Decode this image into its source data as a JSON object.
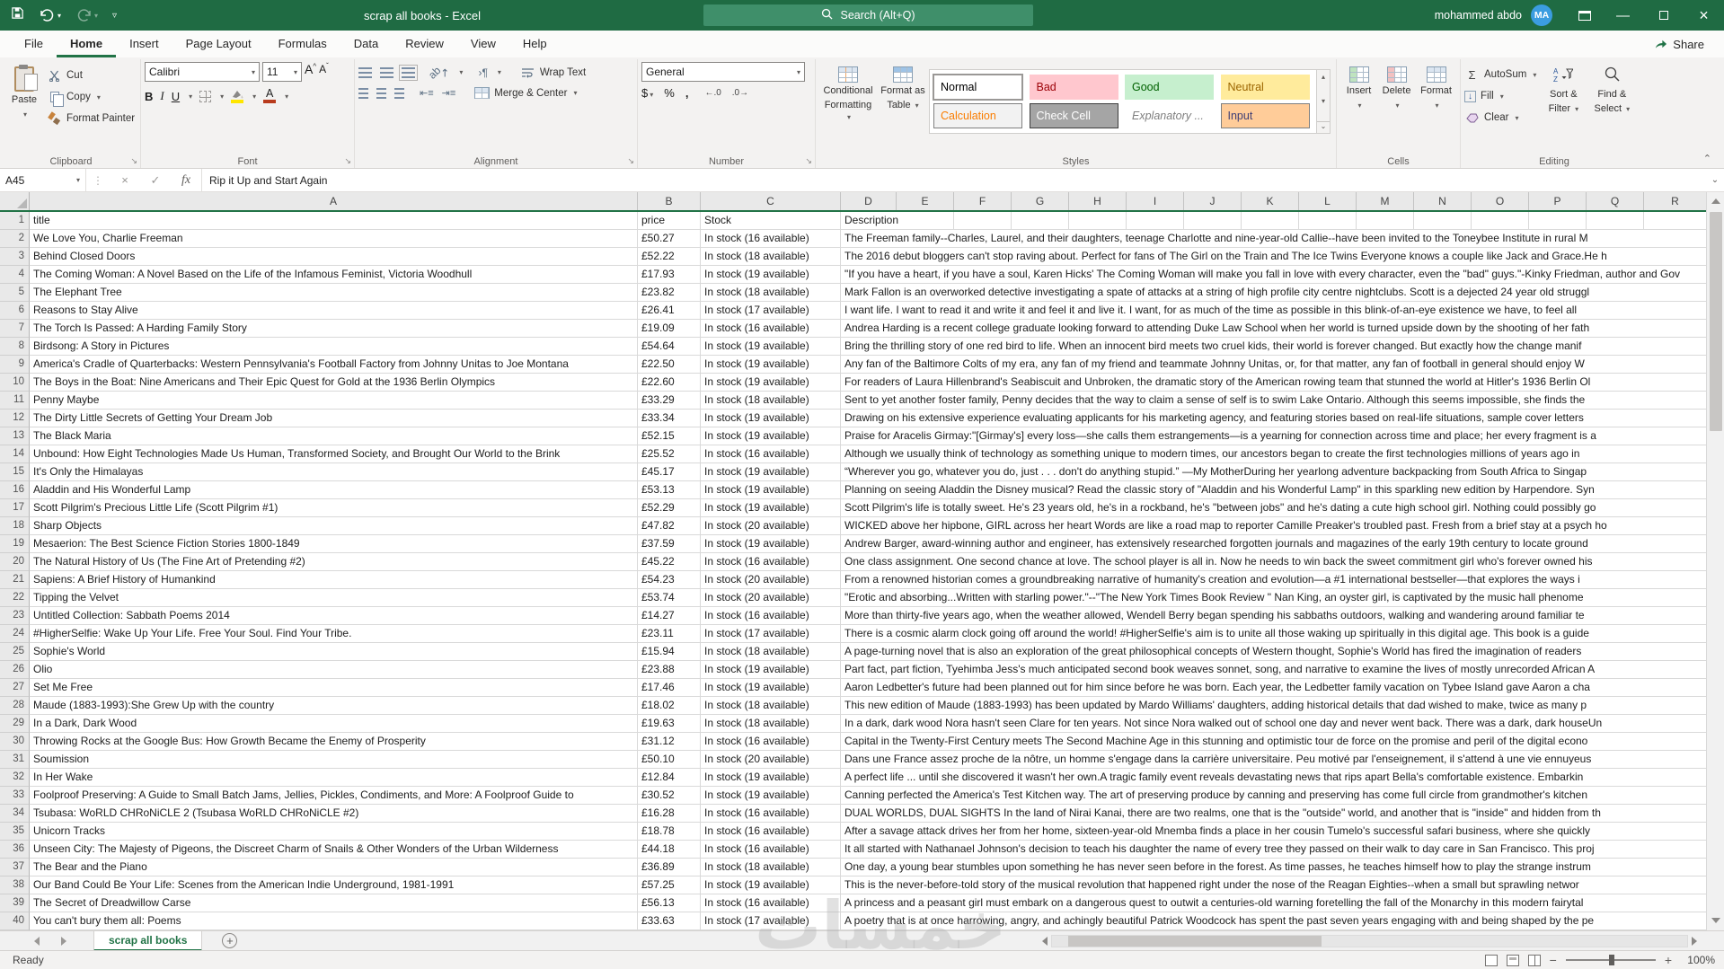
{
  "colors": {
    "accent": "#217346",
    "titlebar_green": "#1f6b43",
    "search_green": "#3f8f6a",
    "avatar_blue": "#3b9de0",
    "fill_bar_yellow": "#ffe600",
    "font_color_bar": "#b83b1d",
    "gridline": "#d9d9d9"
  },
  "icons": {
    "caret": "▾",
    "launcher": "↘",
    "check": "✓",
    "close": "×",
    "minimize": "—",
    "dots": "⋮",
    "up": "▴",
    "down": "▾",
    "more": "⌄",
    "plus": "+",
    "paragraph": "¶",
    "sigma": "Σ",
    "expand": "⌄",
    "fill_arrow": "↓",
    "az_a": "A",
    "az_z": "Z"
  },
  "titlebar": {
    "title": "scrap all books - Excel",
    "search_placeholder": "Search (Alt+Q)",
    "user": "mohammed abdo",
    "avatar_initials": "MA"
  },
  "menu": {
    "tabs": [
      "File",
      "Home",
      "Insert",
      "Page Layout",
      "Formulas",
      "Data",
      "Review",
      "View",
      "Help"
    ],
    "active": "Home",
    "share": "Share"
  },
  "ribbon": {
    "clipboard": {
      "label": "Clipboard",
      "paste": "Paste",
      "cut": "Cut",
      "copy": "Copy",
      "format_painter": "Format Painter"
    },
    "font": {
      "label": "Font",
      "family": "Calibri",
      "size": "11",
      "bold": "B",
      "italic": "I",
      "underline": "U",
      "grow": "A",
      "shrink": "A",
      "color_a": "A",
      "ab": "ab"
    },
    "alignment": {
      "label": "Alignment",
      "wrap": "Wrap Text",
      "merge": "Merge & Center"
    },
    "number": {
      "label": "Number",
      "format": "General",
      "currency": "$",
      "percent": "%",
      "comma": ",",
      "inc": "←.0",
      "dec": ".0→"
    },
    "styles": {
      "label": "Styles",
      "conditional_1": "Conditional",
      "conditional_2": "Formatting",
      "format_table_1": "Format as",
      "format_table_2": "Table",
      "chips": [
        {
          "label": "Normal",
          "bg": "#ffffff",
          "color": "#000000",
          "border": "#ababab",
          "selected": true
        },
        {
          "label": "Calculation",
          "bg": "#f2f2f2",
          "color": "#fa7d00",
          "border": "#7f7f7f"
        },
        {
          "label": "Bad",
          "bg": "#ffc7ce",
          "color": "#9c0006"
        },
        {
          "label": "Check Cell",
          "bg": "#a5a5a5",
          "color": "#ffffff",
          "border": "#3f3f3f"
        },
        {
          "label": "Good",
          "bg": "#c6efce",
          "color": "#006100"
        },
        {
          "label": "Explanatory ...",
          "bg": "#ffffff",
          "color": "#7f7f7f",
          "italic": true
        },
        {
          "label": "Neutral",
          "bg": "#ffeb9c",
          "color": "#9c6500"
        },
        {
          "label": "Input",
          "bg": "#ffcc99",
          "color": "#3f3f76",
          "border": "#7f7f7f"
        }
      ]
    },
    "cells": {
      "label": "Cells",
      "insert": "Insert",
      "delete": "Delete",
      "format": "Format"
    },
    "editing": {
      "label": "Editing",
      "autosum": "AutoSum",
      "fill": "Fill",
      "clear": "Clear",
      "sort_1": "Sort &",
      "sort_2": "Filter",
      "find_1": "Find &",
      "find_2": "Select"
    }
  },
  "formula_bar": {
    "name_box": "A45",
    "fx": "fx",
    "value": "Rip it Up and Start Again"
  },
  "grid": {
    "col_letters": [
      "A",
      "B",
      "C",
      "D",
      "E",
      "F",
      "G",
      "H",
      "I",
      "J",
      "K",
      "L",
      "M",
      "N",
      "O",
      "P",
      "Q",
      "R"
    ],
    "header_row": {
      "n": 1,
      "title": "title",
      "price": "price",
      "stock": "Stock",
      "desc": "Description"
    },
    "rows": [
      {
        "n": 2,
        "title": "We Love You, Charlie Freeman",
        "price": "£50.27",
        "stock": "In stock (16 available)",
        "desc": "The Freeman family--Charles, Laurel, and their daughters, teenage Charlotte and nine-year-old Callie--have been invited to the Toneybee Institute in rural M"
      },
      {
        "n": 3,
        "title": "Behind Closed Doors",
        "price": "£52.22",
        "stock": "In stock (18 available)",
        "desc": "The 2016 debut bloggers can't stop raving about. Perfect for fans of The Girl on the Train and The Ice Twins Everyone knows a couple like Jack and Grace.He h"
      },
      {
        "n": 4,
        "title": "The Coming Woman: A Novel Based on the Life of the Infamous Feminist, Victoria Woodhull",
        "price": "£17.93",
        "stock": "In stock (19 available)",
        "desc": "\"If you have a heart, if you have a soul, Karen Hicks' The Coming Woman will make you fall in love with every character, even the \"bad\" guys.\"-Kinky Friedman, author and Gov"
      },
      {
        "n": 5,
        "title": "The Elephant Tree",
        "price": "£23.82",
        "stock": "In stock (18 available)",
        "desc": "Mark Fallon is an overworked detective investigating a spate of attacks at a string of high profile city centre nightclubs. Scott is a dejected 24 year old struggl"
      },
      {
        "n": 6,
        "title": "Reasons to Stay Alive",
        "price": "£26.41",
        "stock": "In stock (17 available)",
        "desc": "I want life. I want to read it and write it and feel it and live it. I want, for as much of the time as possible in this blink-of-an-eye existence we have, to feel all"
      },
      {
        "n": 7,
        "title": "The Torch Is Passed: A Harding Family Story",
        "price": "£19.09",
        "stock": "In stock (16 available)",
        "desc": "Andrea Harding is a recent college graduate looking forward to attending Duke Law School when her world is turned upside down by the shooting of her fath"
      },
      {
        "n": 8,
        "title": "Birdsong: A Story in Pictures",
        "price": "£54.64",
        "stock": "In stock (19 available)",
        "desc": "Bring the thrilling story of one red bird to life. When an innocent bird meets two cruel kids, their world is forever changed. But exactly how the change manif"
      },
      {
        "n": 9,
        "title": "America's Cradle of Quarterbacks: Western Pennsylvania's Football Factory from Johnny Unitas to Joe Montana",
        "price": "£22.50",
        "stock": "In stock (19 available)",
        "desc": "Any fan of the Baltimore Colts of my era, any fan of my friend and teammate Johnny Unitas, or, for that matter, any fan of football in general should enjoy W"
      },
      {
        "n": 10,
        "title": "The Boys in the Boat: Nine Americans and Their Epic Quest for Gold at the 1936 Berlin Olympics",
        "price": "£22.60",
        "stock": "In stock (19 available)",
        "desc": "For readers of Laura Hillenbrand's Seabiscuit and Unbroken, the dramatic story of the American rowing team that stunned the world at Hitler's 1936 Berlin Ol"
      },
      {
        "n": 11,
        "title": "Penny Maybe",
        "price": "£33.29",
        "stock": "In stock (18 available)",
        "desc": "Sent to yet another foster family, Penny decides that the way to claim a sense of self is to swim Lake Ontario. Although this seems impossible, she finds the"
      },
      {
        "n": 12,
        "title": "The Dirty Little Secrets of Getting Your Dream Job",
        "price": "£33.34",
        "stock": "In stock (19 available)",
        "desc": "Drawing on his extensive experience evaluating applicants for his marketing agency, and featuring stories based on real-life situations, sample cover letters"
      },
      {
        "n": 13,
        "title": "The Black Maria",
        "price": "£52.15",
        "stock": "In stock (19 available)",
        "desc": "Praise for Aracelis Girmay:\"[Girmay's] every loss—she calls them estrangements—is a yearning for connection across time and place; her every fragment is a"
      },
      {
        "n": 14,
        "title": "Unbound: How Eight Technologies Made Us Human, Transformed Society, and Brought Our World to the Brink",
        "price": "£25.52",
        "stock": "In stock (16 available)",
        "desc": "Although we usually think of technology as something unique to modern times, our ancestors began to create the first technologies millions of years ago in"
      },
      {
        "n": 15,
        "title": "It's Only the Himalayas",
        "price": "£45.17",
        "stock": "In stock (19 available)",
        "desc": "“Wherever you go, whatever you do, just . . . don't do anything stupid.” —My MotherDuring her yearlong adventure backpacking from South Africa to Singap"
      },
      {
        "n": 16,
        "title": "Aladdin and His Wonderful Lamp",
        "price": "£53.13",
        "stock": "In stock (19 available)",
        "desc": "Planning on seeing Aladdin the Disney musical? Read the classic story of \"Aladdin and his Wonderful Lamp\" in this sparkling new edition by Harpendore. Syn"
      },
      {
        "n": 17,
        "title": "Scott Pilgrim's Precious Little Life (Scott Pilgrim #1)",
        "price": "£52.29",
        "stock": "In stock (19 available)",
        "desc": "Scott Pilgrim's life is totally sweet. He's 23 years old, he's in a rockband, he's \"between jobs\" and he's dating a cute high school girl. Nothing could possibly go"
      },
      {
        "n": 18,
        "title": "Sharp Objects",
        "price": "£47.82",
        "stock": "In stock (20 available)",
        "desc": "WICKED above her hipbone, GIRL across her heart Words are like a road map to reporter Camille Preaker's troubled past. Fresh from a brief stay at a psych ho"
      },
      {
        "n": 19,
        "title": "Mesaerion: The Best Science Fiction Stories 1800-1849",
        "price": "£37.59",
        "stock": "In stock (19 available)",
        "desc": "Andrew Barger, award-winning author and engineer, has extensively researched forgotten journals and magazines of the early 19th century to locate ground"
      },
      {
        "n": 20,
        "title": "The Natural History of Us (The Fine Art of Pretending #2)",
        "price": "£45.22",
        "stock": "In stock (16 available)",
        "desc": "One class assignment. One second chance at love. The school player is all in. Now he needs to win back the sweet commitment girl who's forever owned his"
      },
      {
        "n": 21,
        "title": "Sapiens: A Brief History of Humankind",
        "price": "£54.23",
        "stock": "In stock (20 available)",
        "desc": "From a renowned historian comes a groundbreaking narrative of humanity's creation and evolution—a #1 international bestseller—that explores the ways i"
      },
      {
        "n": 22,
        "title": "Tipping the Velvet",
        "price": "£53.74",
        "stock": "In stock (20 available)",
        "desc": "\"Erotic and absorbing...Written with starling power.\"--\"The New York Times Book Review \" Nan King, an oyster girl, is captivated by the music hall phenome"
      },
      {
        "n": 23,
        "title": "Untitled Collection: Sabbath Poems 2014",
        "price": "£14.27",
        "stock": "In stock (16 available)",
        "desc": "More than thirty-five years ago, when the weather allowed, Wendell Berry began spending his sabbaths outdoors, walking and wandering around familiar te"
      },
      {
        "n": 24,
        "title": "#HigherSelfie: Wake Up Your Life. Free Your Soul. Find Your Tribe.",
        "price": "£23.11",
        "stock": "In stock (17 available)",
        "desc": "There is a cosmic alarm clock going off around the world! #HigherSelfie's aim is to unite all those waking up spiritually in this digital age. This book is a guide"
      },
      {
        "n": 25,
        "title": "Sophie's World",
        "price": "£15.94",
        "stock": "In stock (18 available)",
        "desc": "A page-turning novel that is also an exploration of the great philosophical concepts of Western thought, Sophie's World has fired the imagination of readers"
      },
      {
        "n": 26,
        "title": "Olio",
        "price": "£23.88",
        "stock": "In stock (19 available)",
        "desc": "Part fact, part fiction, Tyehimba Jess's much anticipated second book weaves sonnet, song, and narrative to examine the lives of mostly unrecorded African A"
      },
      {
        "n": 27,
        "title": "Set Me Free",
        "price": "£17.46",
        "stock": "In stock (19 available)",
        "desc": "Aaron Ledbetter's future had been planned out for him since before he was born. Each year, the Ledbetter family vacation on Tybee Island gave Aaron a cha"
      },
      {
        "n": 28,
        "title": "Maude (1883-1993):She Grew Up with the country",
        "price": "£18.02",
        "stock": "In stock (18 available)",
        "desc": "This new edition of Maude (1883-1993) has been updated by Mardo Williams' daughters, adding historical details that dad wished to make, twice as many p"
      },
      {
        "n": 29,
        "title": "In a Dark, Dark Wood",
        "price": "£19.63",
        "stock": "In stock (18 available)",
        "desc": "In a dark, dark wood Nora hasn't seen Clare for ten years. Not since Nora walked out of school one day and never went back. There was a dark, dark houseUn"
      },
      {
        "n": 30,
        "title": "Throwing Rocks at the Google Bus: How Growth Became the Enemy of Prosperity",
        "price": "£31.12",
        "stock": "In stock (16 available)",
        "desc": "Capital in the Twenty-First Century meets The Second Machine Age in this stunning and optimistic tour de force on the promise and peril of the digital econo"
      },
      {
        "n": 31,
        "title": "Soumission",
        "price": "£50.10",
        "stock": "In stock (20 available)",
        "desc": "Dans une France assez proche de la nôtre, un homme s'engage dans la carrière universitaire. Peu motivé par l'enseignement, il s'attend à une vie ennuyeus"
      },
      {
        "n": 32,
        "title": "In Her Wake",
        "price": "£12.84",
        "stock": "In stock (19 available)",
        "desc": "A perfect life ... until she discovered it wasn't her own.A tragic family event reveals devastating news that rips apart Bella's comfortable existence. Embarkin"
      },
      {
        "n": 33,
        "title": "Foolproof Preserving: A Guide to Small Batch Jams, Jellies, Pickles, Condiments, and More: A Foolproof Guide to",
        "price": "£30.52",
        "stock": "In stock (19 available)",
        "desc": "Canning perfected the America's Test Kitchen way. The art of preserving produce by canning and preserving has come full circle from grandmother's kitchen"
      },
      {
        "n": 34,
        "title": "Tsubasa: WoRLD CHRoNiCLE 2 (Tsubasa WoRLD CHRoNiCLE #2)",
        "price": "£16.28",
        "stock": "In stock (16 available)",
        "desc": "DUAL WORLDS, DUAL SIGHTS In the land of Nirai Kanai, there are two realms, one that is the \"outside\" world, and another that is \"inside\" and hidden from th"
      },
      {
        "n": 35,
        "title": "Unicorn Tracks",
        "price": "£18.78",
        "stock": "In stock (16 available)",
        "desc": "After a savage attack drives her from her home, sixteen-year-old Mnemba finds a place in her cousin Tumelo's successful safari business, where she quickly"
      },
      {
        "n": 36,
        "title": "Unseen City: The Majesty of Pigeons, the Discreet Charm of Snails & Other Wonders of the Urban Wilderness",
        "price": "£44.18",
        "stock": "In stock (16 available)",
        "desc": "It all started with Nathanael Johnson's decision to teach his daughter the name of every tree they passed on their walk to day care in San Francisco. This proj"
      },
      {
        "n": 37,
        "title": "The Bear and the Piano",
        "price": "£36.89",
        "stock": "In stock (18 available)",
        "desc": "One day, a young bear stumbles upon something he has never seen before in the forest. As time passes, he teaches himself how to play the strange instrum"
      },
      {
        "n": 38,
        "title": "Our Band Could Be Your Life: Scenes from the American Indie Underground, 1981-1991",
        "price": "£57.25",
        "stock": "In stock (19 available)",
        "desc": "This is the never-before-told story of the musical revolution that happened right under the nose of the Reagan Eighties--when a small but sprawling networ"
      },
      {
        "n": 39,
        "title": "The Secret of Dreadwillow Carse",
        "price": "£56.13",
        "stock": "In stock (16 available)",
        "desc": "A princess and a peasant girl must embark on a dangerous quest to outwit a centuries-old warning foretelling the fall of the Monarchy in this modern fairytal"
      },
      {
        "n": 40,
        "title": "You can't bury them all: Poems",
        "price": "£33.63",
        "stock": "In stock (17 available)",
        "desc": "A poetry that is at once harrowing, angry, and achingly beautiful Patrick Woodcock has spent the past seven years engaging with and being shaped by the pe"
      }
    ]
  },
  "sheet_bar": {
    "active_tab": "scrap all books"
  },
  "status_bar": {
    "status": "Ready",
    "zoom": "100%"
  },
  "watermark": "خمسات"
}
